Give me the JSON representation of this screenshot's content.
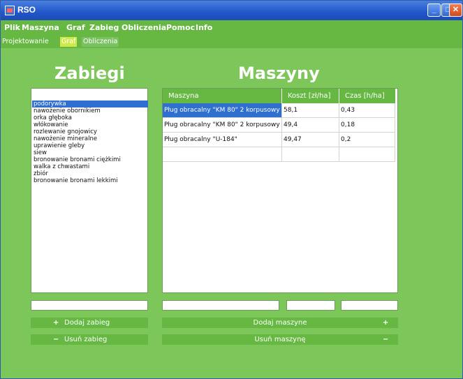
{
  "window": {
    "title": "RSO"
  },
  "menu": [
    "Plik",
    "Maszyna",
    "Graf",
    "Zabieg",
    "Obliczenia",
    "Pomoc",
    "Info"
  ],
  "tabs": [
    "Projektowanie",
    "Graf",
    "Obliczenia"
  ],
  "zabiegi": {
    "heading": "Zabiegi",
    "items": [
      "podorywka",
      "nawożenie obornikiem",
      "orka głęboka",
      "włókowanie",
      "rozlewanie gnojowicy",
      "nawożenie mineralne",
      "uprawienie gleby",
      "siew",
      "bronowanie bronami ciężkimi",
      "walka z chwastami",
      "zbiór",
      "bronowanie bronami lekkimi"
    ],
    "add_label": "Dodaj zabieg",
    "remove_label": "Usuń zabieg",
    "add_symbol": "+",
    "remove_symbol": "−"
  },
  "maszyny": {
    "heading": "Maszyny",
    "columns": [
      "Maszyna",
      "Koszt [zł/ha]",
      "Czas [h/ha]"
    ],
    "rows": [
      [
        "Pług obracalny \"KM 80\" 2 korpusowy",
        "58,1",
        "0,43"
      ],
      [
        "Pług obracalny \"KM 80\" 2 korpusowy",
        "49,4",
        "0,18"
      ],
      [
        "Pług obracalny \"U-184\"",
        "49,47",
        "0,2"
      ]
    ],
    "add_label": "Dodaj maszyne",
    "remove_label": "Usuń maszynę",
    "add_symbol": "+",
    "remove_symbol": "−"
  },
  "window_buttons": {
    "minimize": "_",
    "maximize": "□",
    "close": "✕"
  }
}
